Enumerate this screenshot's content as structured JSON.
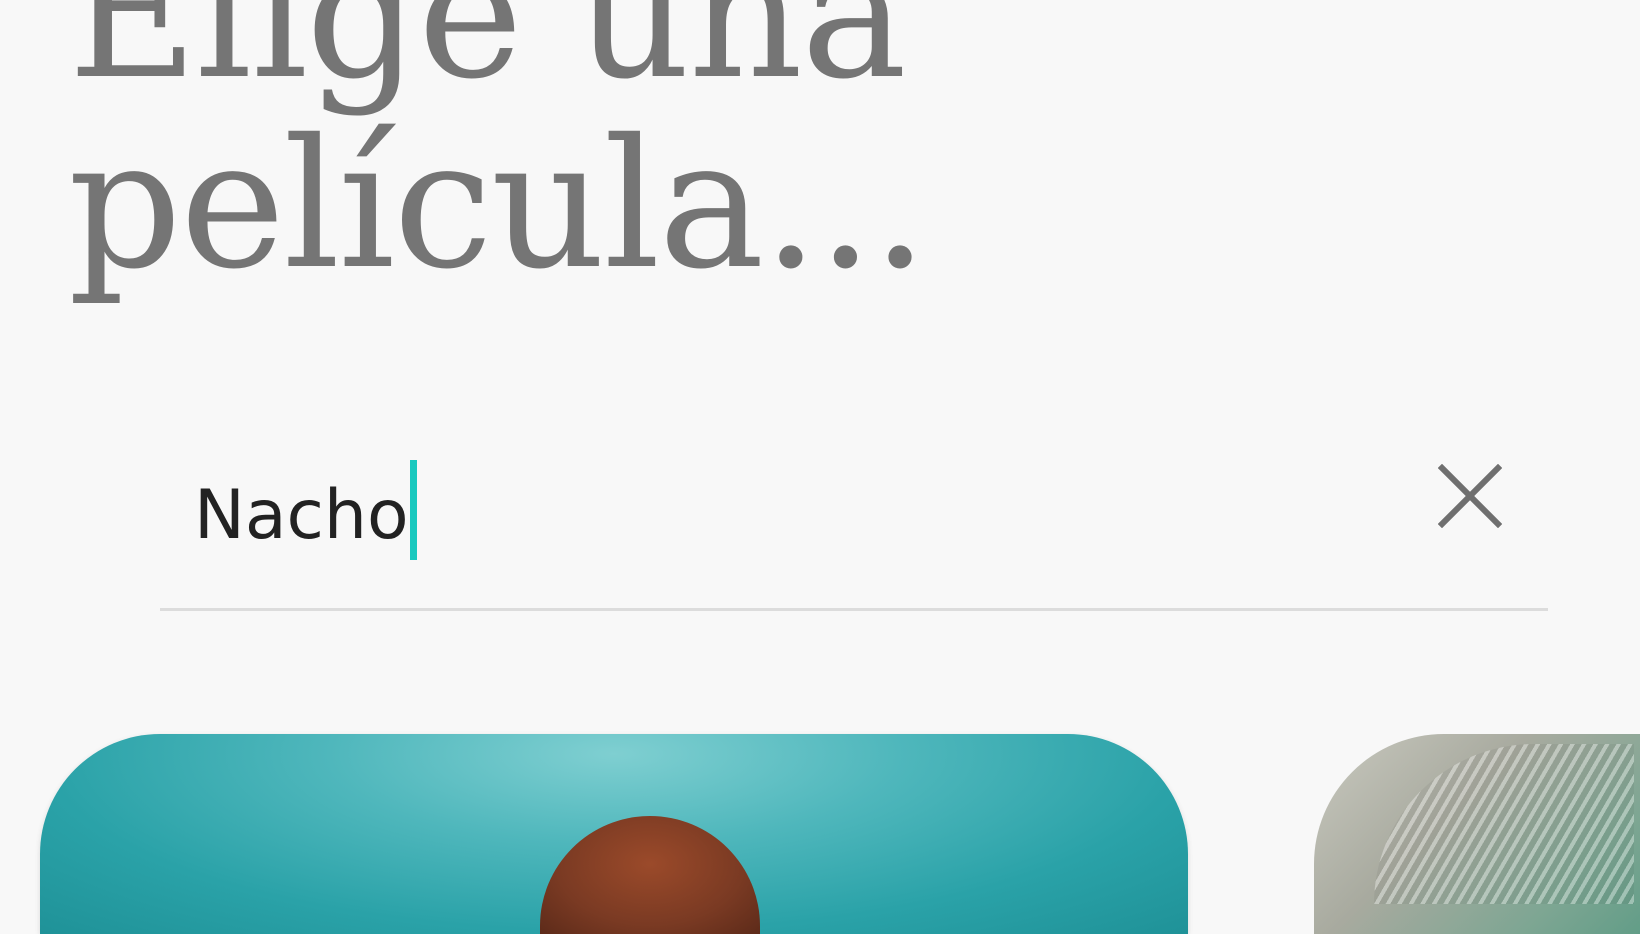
{
  "page": {
    "heading_line1": "Elige una",
    "heading_line2": "película..."
  },
  "search": {
    "value": "Nacho",
    "caret_color": "#19c9bf",
    "clear_icon": "close-icon"
  },
  "results": [
    {
      "poster": "movie-poster"
    },
    {
      "poster": "movie-poster"
    }
  ],
  "colors": {
    "background": "#f8f8f8",
    "heading": "#757575",
    "text": "#222222",
    "accent": "#19c9bf"
  }
}
